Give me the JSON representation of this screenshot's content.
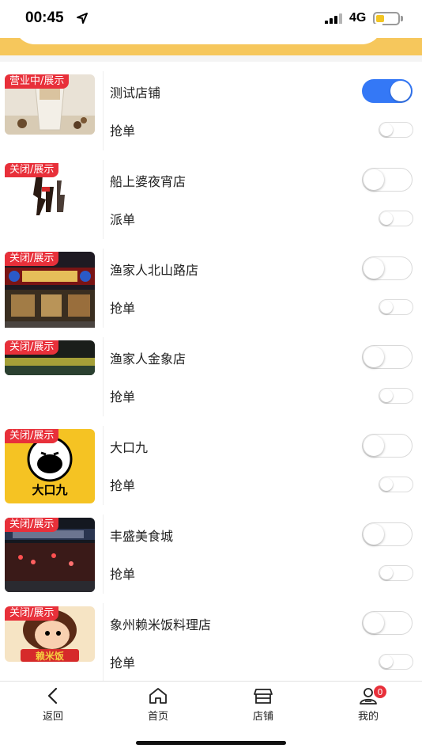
{
  "status_bar": {
    "time": "00:45",
    "network": "4G",
    "battery_color": "#f2c524"
  },
  "colors": {
    "accent_header": "#f6c75c",
    "toggle_on": "#3478f6",
    "tag_red": "#e8303a"
  },
  "stores": [
    {
      "tag": "营业中/展示",
      "name": "测试店铺",
      "order_mode": "抢单",
      "open": true,
      "image": "milk-tea-photo"
    },
    {
      "tag": "关闭/展示",
      "name": "船上婆夜宵店",
      "order_mode": "派单",
      "open": false,
      "image": "calligraphy-logo"
    },
    {
      "tag": "关闭/展示",
      "name": "渔家人北山路店",
      "order_mode": "抢单",
      "open": false,
      "image": "storefront-night-photo"
    },
    {
      "tag": "关闭/展示",
      "name": "渔家人金象店",
      "order_mode": "抢单",
      "open": false,
      "image": "storefront-banner-photo"
    },
    {
      "tag": "关闭/展示",
      "name": "大口九",
      "order_mode": "抢单",
      "open": false,
      "image": "dakoujiu-logo"
    },
    {
      "tag": "关闭/展示",
      "name": "丰盛美食城",
      "order_mode": "抢单",
      "open": false,
      "image": "food-court-night-photo"
    },
    {
      "tag": "关闭/展示",
      "name": "象州赖米饭料理店",
      "order_mode": "抢单",
      "open": false,
      "image": "cartoon-girl-logo"
    }
  ],
  "thumb_text": {
    "dakoujiu": "大口九",
    "laimifan": "赖米饭"
  },
  "tabbar": {
    "back": "返回",
    "home": "首页",
    "store": "店铺",
    "mine": "我的",
    "mine_badge": "0"
  }
}
